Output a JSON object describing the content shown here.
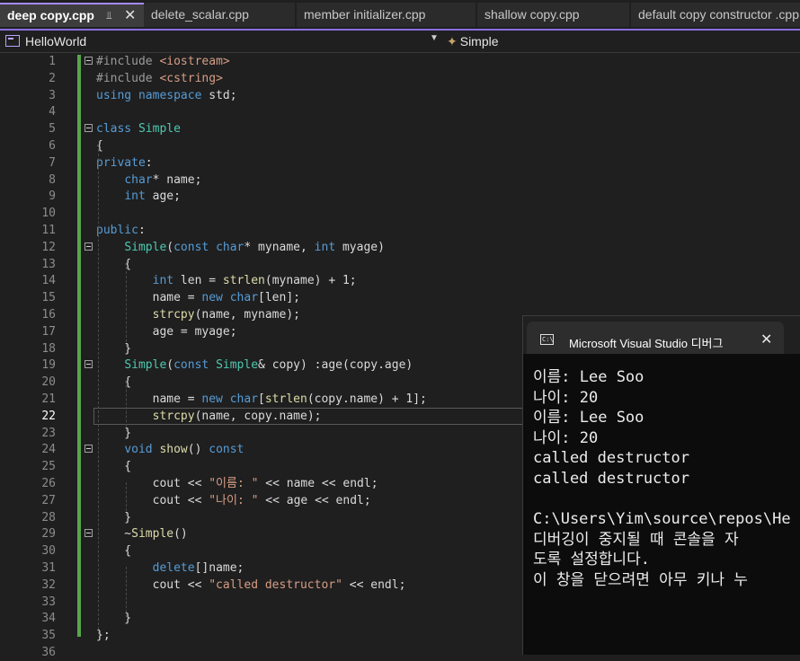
{
  "tabs": [
    {
      "label": "deep copy.cpp",
      "active": true
    },
    {
      "label": "delete_scalar.cpp",
      "active": false
    },
    {
      "label": "member initializer.cpp",
      "active": false
    },
    {
      "label": "shallow copy.cpp",
      "active": false
    },
    {
      "label": "default copy constructor .cpp",
      "active": false
    }
  ],
  "tab_pin_icon": "pin-icon",
  "tab_close_icon": "close-icon",
  "nav": {
    "project": "HelloWorld",
    "scope": "Simple"
  },
  "editor": {
    "current_line": 22,
    "lines": [
      {
        "n": "1",
        "html": "<span class=\"pp\">#include</span> <span class=\"st\">&lt;iostream&gt;</span>"
      },
      {
        "n": "2",
        "html": "<span class=\"pp\">#include</span> <span class=\"st\">&lt;cstring&gt;</span>"
      },
      {
        "n": "3",
        "html": "<span class=\"kw\">using</span> <span class=\"kw\">namespace</span> std;"
      },
      {
        "n": "4",
        "html": ""
      },
      {
        "n": "5",
        "html": "<span class=\"kw\">class</span> <span class=\"ty\">Simple</span>"
      },
      {
        "n": "6",
        "html": "{"
      },
      {
        "n": "7",
        "html": "<span class=\"kw\">private</span>:"
      },
      {
        "n": "8",
        "html": "    <span class=\"kw\">char</span>* name;"
      },
      {
        "n": "9",
        "html": "    <span class=\"kw\">int</span> age;"
      },
      {
        "n": "10",
        "html": ""
      },
      {
        "n": "11",
        "html": "<span class=\"kw\">public</span>:"
      },
      {
        "n": "12",
        "html": "    <span class=\"ty\">Simple</span>(<span class=\"kw\">const</span> <span class=\"kw\">char</span>* myname, <span class=\"kw\">int</span> myage)"
      },
      {
        "n": "13",
        "html": "    {"
      },
      {
        "n": "14",
        "html": "        <span class=\"kw\">int</span> len = <span class=\"fn\">strlen</span>(myname) + 1;"
      },
      {
        "n": "15",
        "html": "        name = <span class=\"kw\">new</span> <span class=\"kw\">char</span>[len];"
      },
      {
        "n": "16",
        "html": "        <span class=\"fn\">strcpy</span>(name, myname);"
      },
      {
        "n": "17",
        "html": "        age = myage;"
      },
      {
        "n": "18",
        "html": "    }"
      },
      {
        "n": "19",
        "html": "    <span class=\"ty\">Simple</span>(<span class=\"kw\">const</span> <span class=\"ty\">Simple</span>&amp; copy) :age(copy.age)"
      },
      {
        "n": "20",
        "html": "    {"
      },
      {
        "n": "21",
        "html": "        name = <span class=\"kw\">new</span> <span class=\"kw\">char</span>[<span class=\"fn\">strlen</span>(copy.name) + 1];"
      },
      {
        "n": "22",
        "html": "        <span class=\"fn\">strcpy</span>(name, copy.name);"
      },
      {
        "n": "23",
        "html": "    }"
      },
      {
        "n": "24",
        "html": "    <span class=\"kw\">void</span> <span class=\"fn\">show</span>() <span class=\"kw\">const</span>"
      },
      {
        "n": "25",
        "html": "    {"
      },
      {
        "n": "26",
        "html": "        cout &lt;&lt; <span class=\"st\">\"이름: \"</span> &lt;&lt; name &lt;&lt; endl;"
      },
      {
        "n": "27",
        "html": "        cout &lt;&lt; <span class=\"st\">\"나이: \"</span> &lt;&lt; age &lt;&lt; endl;"
      },
      {
        "n": "28",
        "html": "    }"
      },
      {
        "n": "29",
        "html": "    ~<span class=\"fn\">Simple</span>()"
      },
      {
        "n": "30",
        "html": "    {"
      },
      {
        "n": "31",
        "html": "        <span class=\"kw\">delete</span>[]name;"
      },
      {
        "n": "32",
        "html": "        cout &lt;&lt; <span class=\"st\">\"called destructor\"</span> &lt;&lt; endl;"
      },
      {
        "n": "33",
        "html": ""
      },
      {
        "n": "34",
        "html": "    }"
      },
      {
        "n": "35",
        "html": "};"
      },
      {
        "n": "36",
        "html": ""
      }
    ]
  },
  "console": {
    "title": "Microsoft Visual Studio 디버그",
    "icon": "terminal-icon",
    "close_icon": "close-icon",
    "output": [
      "이름: Lee Soo",
      "나이: 20",
      "이름: Lee Soo",
      "나이: 20",
      "called destructor",
      "called destructor",
      "",
      "C:\\Users\\Yim\\source\\repos\\He",
      "디버깅이 중지될 때 콘솔을 자",
      "도록 설정합니다.",
      "이 창을 닫으려면 아무 키나 누"
    ]
  }
}
